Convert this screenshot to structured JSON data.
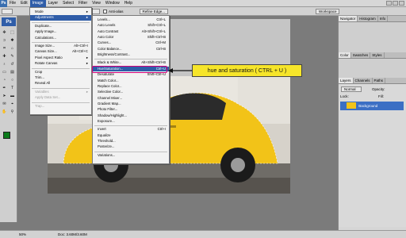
{
  "menubar": {
    "items": [
      "File",
      "Edit",
      "Image",
      "Layer",
      "Select",
      "Filter",
      "View",
      "Window",
      "Help"
    ],
    "active_index": 2
  },
  "options": {
    "mode_label": "Normal",
    "antialias_label": "Anti-alias",
    "refine_label": "Refine Edge...",
    "workspace_label": "Workspace"
  },
  "image_menu": {
    "items": [
      {
        "label": "Mode",
        "sc": "",
        "sub": true
      },
      {
        "label": "Adjustments",
        "sc": "",
        "sub": true,
        "hi": true
      },
      {
        "label": "Duplicate...",
        "sc": ""
      },
      {
        "label": "Apply Image...",
        "sc": ""
      },
      {
        "label": "Calculations...",
        "sc": ""
      },
      {
        "label": "Image Size...",
        "sc": "Alt+Ctrl+I"
      },
      {
        "label": "Canvas Size...",
        "sc": "Alt+Ctrl+C"
      },
      {
        "label": "Pixel Aspect Ratio",
        "sc": "",
        "sub": true
      },
      {
        "label": "Rotate Canvas",
        "sc": "",
        "sub": true
      },
      {
        "label": "Crop",
        "sc": ""
      },
      {
        "label": "Trim...",
        "sc": ""
      },
      {
        "label": "Reveal All",
        "sc": ""
      },
      {
        "label": "Variables",
        "sc": "",
        "sub": true,
        "dis": true
      },
      {
        "label": "Apply Data Set...",
        "sc": "",
        "dis": true
      },
      {
        "label": "Trap...",
        "sc": "",
        "dis": true
      }
    ]
  },
  "adjust_menu": {
    "items": [
      {
        "label": "Levels...",
        "sc": "Ctrl+L"
      },
      {
        "label": "Auto Levels",
        "sc": "Shift+Ctrl+L"
      },
      {
        "label": "Auto Contrast",
        "sc": "Alt+Shift+Ctrl+L"
      },
      {
        "label": "Auto Color",
        "sc": "Shift+Ctrl+B"
      },
      {
        "label": "Curves...",
        "sc": "Ctrl+M"
      },
      {
        "label": "Color Balance...",
        "sc": "Ctrl+B"
      },
      {
        "label": "Brightness/Contrast...",
        "sc": ""
      },
      {
        "label": "Black & White...",
        "sc": "Alt+Shift+Ctrl+B"
      },
      {
        "label": "Hue/Saturation...",
        "sc": "Ctrl+U",
        "hi": true
      },
      {
        "label": "Desaturate",
        "sc": "Shift+Ctrl+U"
      },
      {
        "label": "Match Color...",
        "sc": ""
      },
      {
        "label": "Replace Color...",
        "sc": ""
      },
      {
        "label": "Selective Color...",
        "sc": ""
      },
      {
        "label": "Channel Mixer...",
        "sc": ""
      },
      {
        "label": "Gradient Map...",
        "sc": ""
      },
      {
        "label": "Photo Filter...",
        "sc": ""
      },
      {
        "label": "Shadow/Highlight...",
        "sc": ""
      },
      {
        "label": "Exposure...",
        "sc": ""
      },
      {
        "label": "Invert",
        "sc": "Ctrl+I"
      },
      {
        "label": "Equalize",
        "sc": ""
      },
      {
        "label": "Threshold...",
        "sc": ""
      },
      {
        "label": "Posterize...",
        "sc": ""
      },
      {
        "label": "Variations...",
        "sc": ""
      }
    ]
  },
  "callout": {
    "text": "hue and saturation ( CTRL + U )"
  },
  "panels": {
    "top_tabs": [
      "Navigator",
      "Histogram",
      "Info"
    ],
    "mid_tabs": [
      "Color",
      "Swatches",
      "Styles"
    ],
    "layer_tabs": [
      "Layers",
      "Channels",
      "Paths"
    ],
    "blend_mode": "Normal",
    "opacity_label": "Opacity:",
    "fill_label": "Fill:",
    "lock_label": "Lock:",
    "layer_name": "Background"
  },
  "status": {
    "zoom": "50%",
    "doc": "Doc: 3.60M/3.60M"
  },
  "colors": {
    "fg": "#0a7a1a",
    "car": "#f2c318",
    "highlight": "#2f5da8",
    "callout": "#f6e52a"
  }
}
